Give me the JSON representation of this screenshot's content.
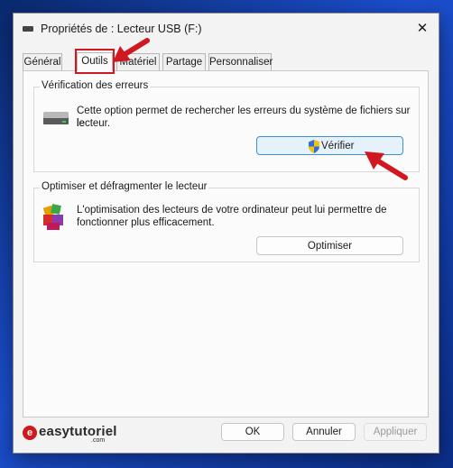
{
  "window": {
    "title": "Propriétés de : Lecteur USB (F:)",
    "close_glyph": "✕"
  },
  "tabs": [
    {
      "label": "Général"
    },
    {
      "label": "Outils"
    },
    {
      "label": "Matériel"
    },
    {
      "label": "Partage"
    },
    {
      "label": "Personnaliser"
    }
  ],
  "active_tab": "Outils",
  "error_check": {
    "title": "Vérification des erreurs",
    "description_line1": "Cette option permet de rechercher les erreurs du système de fichiers sur le",
    "description_line2": "lecteur.",
    "button_label": "Vérifier"
  },
  "optimize": {
    "title": "Optimiser et défragmenter le lecteur",
    "description_line1": "L'optimisation des lecteurs de votre ordinateur peut lui permettre de",
    "description_line2": "fonctionner plus efficacement.",
    "button_label": "Optimiser"
  },
  "footer": {
    "ok_label": "OK",
    "cancel_label": "Annuler",
    "apply_label": "Appliquer",
    "logo_letter": "e",
    "logo_text": "easytutoriel",
    "logo_sub": ".com"
  },
  "colors": {
    "highlight": "#d01821",
    "primary_border": "#3c8fd8",
    "primary_fill": "#e5f1fb"
  },
  "icons": [
    "drive-icon",
    "uac-shield-icon",
    "defrag-icon",
    "close-icon",
    "usb-drive-icon"
  ]
}
